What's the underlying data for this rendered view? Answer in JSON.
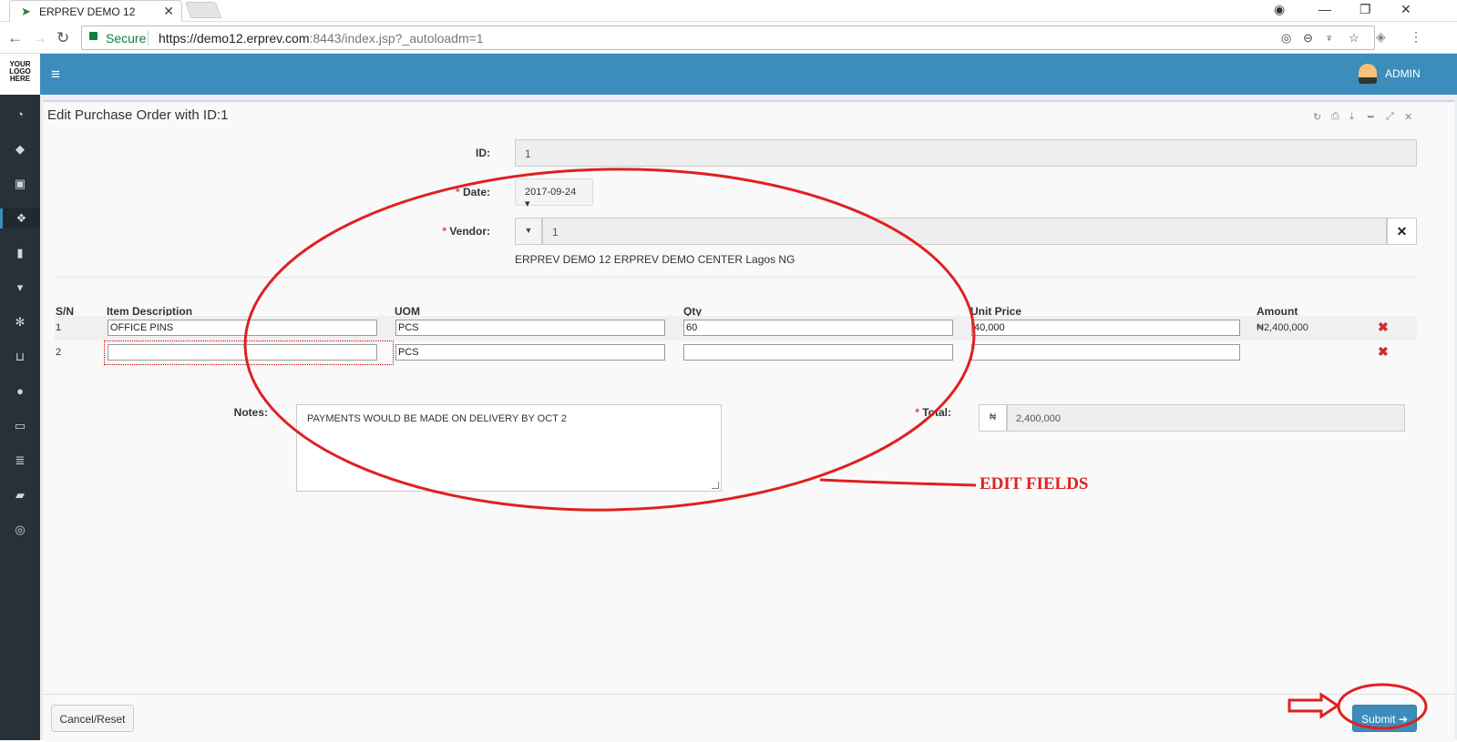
{
  "browser": {
    "tab_title": "ERPREV DEMO 12",
    "tab_close": "✕",
    "secure_label": "Secure",
    "url_main": "https://demo12.erprev.com",
    "url_rest": ":8443/index.jsp?_autoloadm=1"
  },
  "app": {
    "logo_text": "YOUR LOGO HERE",
    "user": "ADMIN",
    "header_color": "#3c8dbc"
  },
  "sidebar": {
    "items": [
      {
        "icon": "dashboard-icon",
        "glyph": "◔"
      },
      {
        "icon": "tag-icon",
        "glyph": "◆"
      },
      {
        "icon": "money-icon",
        "glyph": "▣"
      },
      {
        "icon": "cubes-icon",
        "glyph": "❖"
      },
      {
        "icon": "building-icon",
        "glyph": "▮"
      },
      {
        "icon": "trash-icon",
        "glyph": "▾"
      },
      {
        "icon": "snowflake-icon",
        "glyph": "✻"
      },
      {
        "icon": "cart-icon",
        "glyph": "⊔"
      },
      {
        "icon": "circle-icon",
        "glyph": "●"
      },
      {
        "icon": "desktop-icon",
        "glyph": "▭"
      },
      {
        "icon": "database-icon",
        "glyph": "≣"
      },
      {
        "icon": "book-icon",
        "glyph": "▰"
      },
      {
        "icon": "lifebuoy-icon",
        "glyph": "◎"
      }
    ]
  },
  "panel": {
    "title": "Edit Purchase Order with ID:1"
  },
  "form": {
    "id_label": "ID:",
    "id_value": "1",
    "date_label": "Date:",
    "date_value": "2017-09-24",
    "vendor_label": "Vendor:",
    "vendor_value": "1",
    "vendor_desc": "ERPREV DEMO 12 ERPREV DEMO CENTER Lagos NG",
    "required_mark": "*",
    "notes_label": "Notes:",
    "notes_value": "PAYMENTS WOULD BE MADE ON DELIVERY BY OCT 2",
    "total_label": "Total:",
    "currency": "₦",
    "total_value": "2,400,000"
  },
  "table": {
    "headers": [
      "S/N",
      "Item Description",
      "UOM",
      "Qty",
      "Unit Price",
      "Amount"
    ],
    "rows": [
      {
        "sn": "1",
        "desc": "OFFICE PINS",
        "uom": "PCS",
        "qty": "60",
        "price": "40,000",
        "amount": "₦2,400,000"
      },
      {
        "sn": "2",
        "desc": "",
        "uom": "PCS",
        "qty": "",
        "price": "",
        "amount": ""
      }
    ]
  },
  "footer": {
    "cancel_label": "Cancel/Reset",
    "submit_label": "Submit"
  },
  "annotation": {
    "text": "EDIT FIELDS",
    "color": "#e02020"
  }
}
